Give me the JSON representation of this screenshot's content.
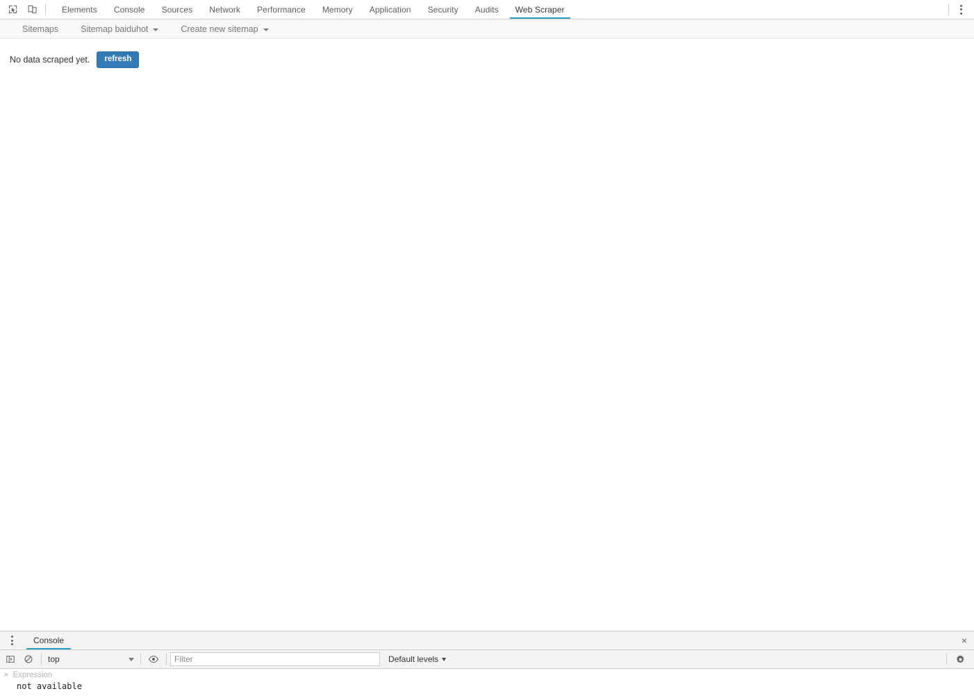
{
  "devtools": {
    "icons": {
      "inspect": "inspect-element-icon",
      "device": "device-toolbar-icon",
      "more": "more-options-icon"
    },
    "tabs": [
      {
        "label": "Elements",
        "active": false
      },
      {
        "label": "Console",
        "active": false
      },
      {
        "label": "Sources",
        "active": false
      },
      {
        "label": "Network",
        "active": false
      },
      {
        "label": "Performance",
        "active": false
      },
      {
        "label": "Memory",
        "active": false
      },
      {
        "label": "Application",
        "active": false
      },
      {
        "label": "Security",
        "active": false
      },
      {
        "label": "Audits",
        "active": false
      },
      {
        "label": "Web Scraper",
        "active": true
      }
    ],
    "active_tab_underline_color": "#2ca0c4"
  },
  "web_scraper": {
    "navbar": {
      "sitemaps_label": "Sitemaps",
      "sitemap_label": "Sitemap baiduhot",
      "create_sitemap_label": "Create new sitemap"
    },
    "content": {
      "status_text": "No data scraped yet.",
      "refresh_button_label": "refresh",
      "refresh_button_color": "#337ab7"
    }
  },
  "drawer": {
    "tab_label": "Console",
    "close_label": "×",
    "toolbar": {
      "sidebar_toggle": "console-sidebar-toggle-icon",
      "clear_console": "clear-console-icon",
      "context_value": "top",
      "live_expression": "eye-icon",
      "filter_placeholder": "Filter",
      "filter_value": "",
      "levels_label": "Default levels",
      "settings": "gear-icon"
    },
    "watch": {
      "close": "×",
      "expression_placeholder": "Expression",
      "result_text": "not available"
    }
  }
}
